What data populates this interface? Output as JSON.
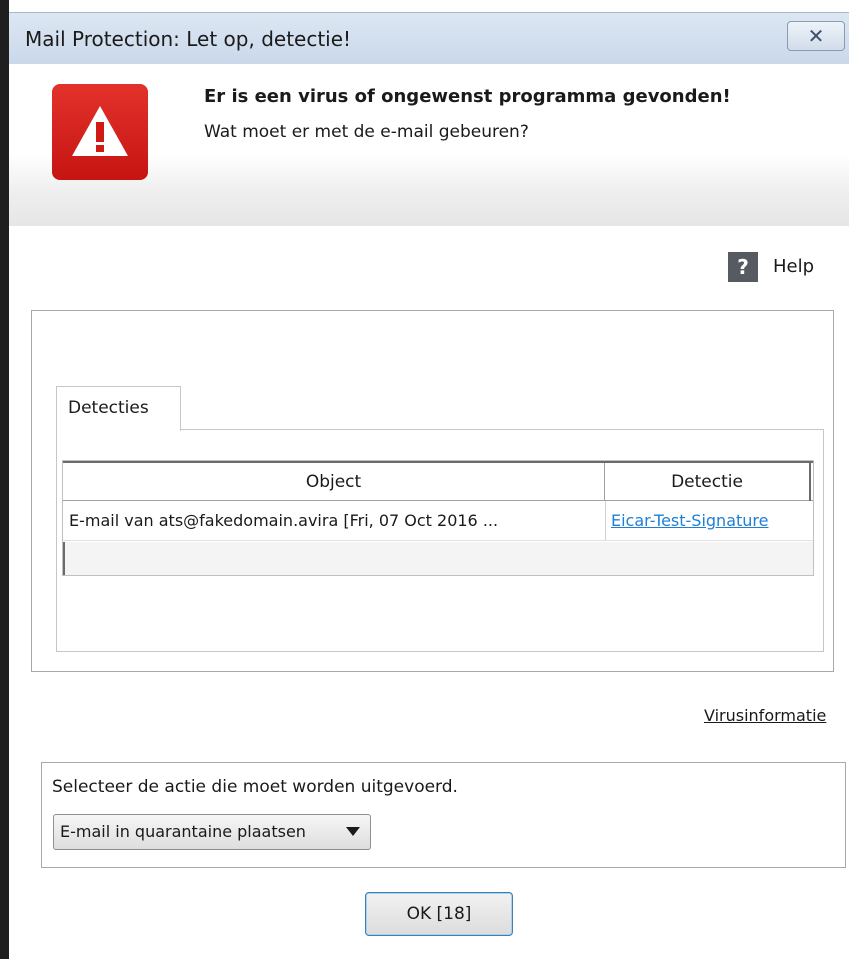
{
  "window": {
    "title": "Mail Protection: Let op, detectie!",
    "close_glyph": "✕"
  },
  "header": {
    "icon": "warning-triangle-icon",
    "title": "Er is een virus of ongewenst programma gevonden!",
    "subtitle": "Wat moet er met de e-mail gebeuren?",
    "warn_color": "#d8211c"
  },
  "help": {
    "icon_glyph": "?",
    "label": "Help"
  },
  "detections": {
    "tab_label": "Detecties",
    "columns": [
      "Object",
      "Detectie"
    ],
    "rows": [
      {
        "object": "E-mail van ats@fakedomain.avira [Fri, 07 Oct 2016 ...",
        "detection": "Eicar-Test-Signature"
      }
    ]
  },
  "virus_info_link": "Virusinformatie",
  "action": {
    "label": "Selecteer de actie die moet worden uitgevoerd.",
    "selected": "E-mail in quarantaine plaatsen"
  },
  "ok_button": "OK [18]",
  "colors": {
    "link": "#1f7fd6",
    "titlebar": "#d3dfee"
  }
}
